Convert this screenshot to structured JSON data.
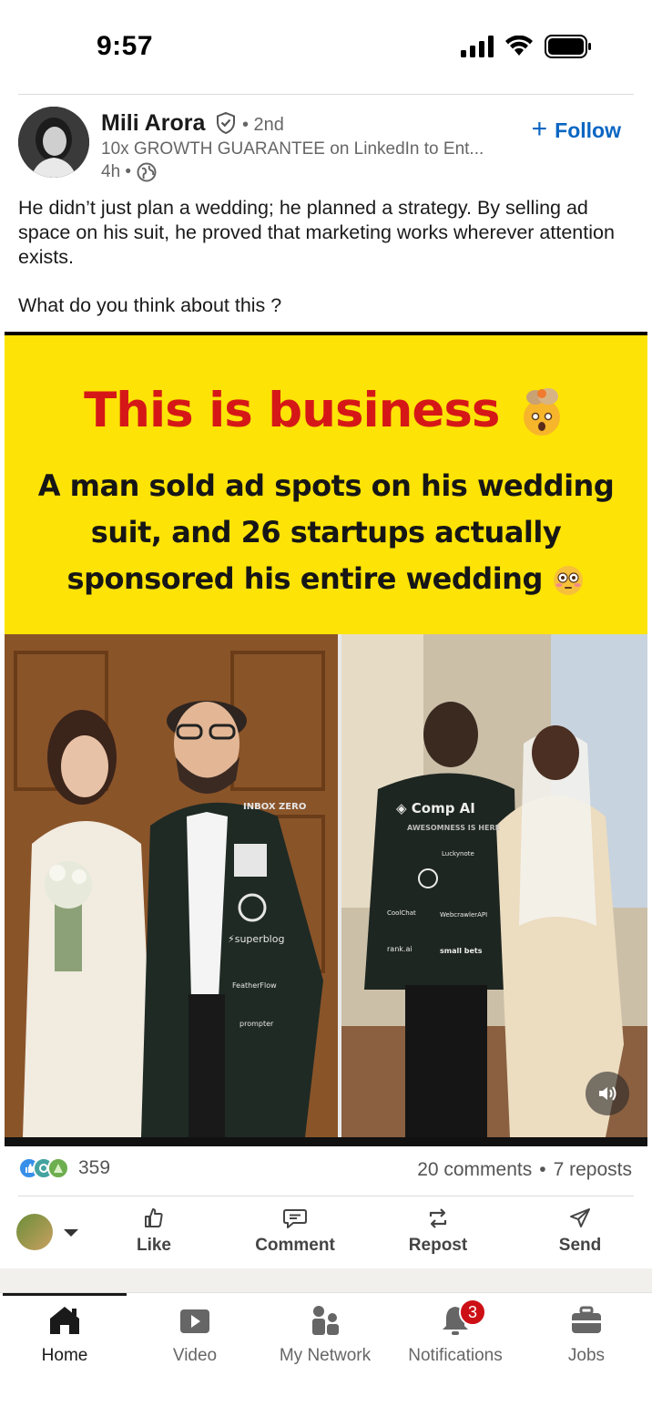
{
  "status_bar": {
    "time": "9:57",
    "signal_icon": "cellular-signal-icon",
    "wifi_icon": "wifi-icon",
    "battery_icon": "battery-icon"
  },
  "post": {
    "author": {
      "name": "Mili Arora",
      "verified_icon": "verified-shield-icon",
      "degree": "• 2nd",
      "headline": "10x GROWTH GUARANTEE on LinkedIn to Ent...",
      "time": "4h •",
      "visibility_icon": "globe-icon"
    },
    "follow_label": "Follow",
    "text": "He didn’t just plan a wedding; he planned a strategy. By selling ad space on his suit, he proved that marketing works wherever attention exists.",
    "question": "What do you think about this ?",
    "media": {
      "banner_title": "This is business",
      "banner_subtitle_1": "A man sold ad spots on his wedding",
      "banner_subtitle_2": "suit, and 26 startups actually",
      "banner_subtitle_3": "sponsored his entire wedding",
      "suit_logos_left": [
        "INBOX ZERO",
        "superblog",
        "FeatherFlow",
        "prompter"
      ],
      "suit_logos_right": [
        "Comp AI",
        "AWESOMNESS IS HERE",
        "Luckynote",
        "CoolChat",
        "WebcrawlerAPI",
        "rank.ai",
        "small bets"
      ],
      "sound_icon": "speaker-icon"
    },
    "reactions": {
      "icons": [
        "like-reaction-icon",
        "celebrate-reaction-icon",
        "support-reaction-icon"
      ],
      "count": "359"
    },
    "comments": "20 comments",
    "dot": "•",
    "reposts": "7 reposts",
    "actions": [
      {
        "label": "Like",
        "icon": "thumbs-up-icon"
      },
      {
        "label": "Comment",
        "icon": "comment-icon"
      },
      {
        "label": "Repost",
        "icon": "repost-icon"
      },
      {
        "label": "Send",
        "icon": "send-icon"
      }
    ]
  },
  "bottom_nav": {
    "items": [
      {
        "label": "Home",
        "icon": "home-icon"
      },
      {
        "label": "Video",
        "icon": "video-icon"
      },
      {
        "label": "My Network",
        "icon": "network-icon"
      },
      {
        "label": "Notifications",
        "icon": "bell-icon",
        "badge": "3"
      },
      {
        "label": "Jobs",
        "icon": "briefcase-icon"
      }
    ]
  },
  "colors": {
    "linkedin_blue": "#0a66c2",
    "banner_yellow": "#fde306",
    "banner_red": "#d51817",
    "badge_red": "#cc1016"
  }
}
